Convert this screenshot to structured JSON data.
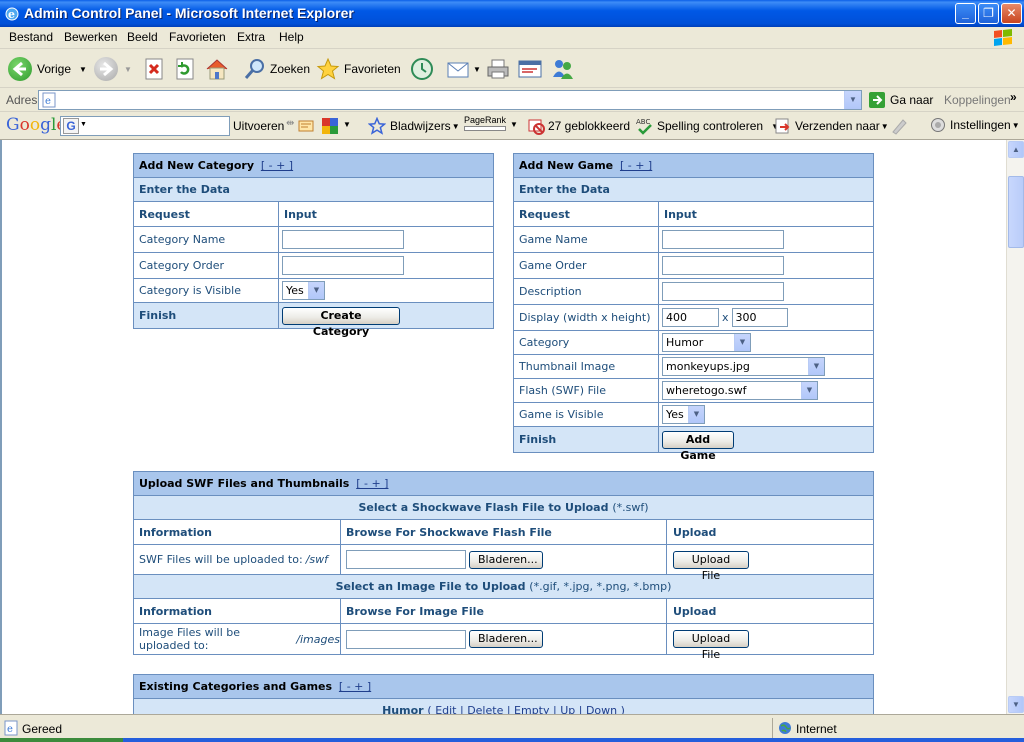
{
  "window": {
    "title": "Admin Control Panel - Microsoft Internet Explorer",
    "buttons": [
      "_",
      "❐",
      "✕"
    ]
  },
  "menu": [
    "Bestand",
    "Bewerken",
    "Beeld",
    "Favorieten",
    "Extra",
    "Help"
  ],
  "toolbar": {
    "back": "Vorige",
    "search": "Zoeken",
    "favorites": "Favorieten"
  },
  "address": {
    "label": "Adres",
    "value": "",
    "go": "Ga naar",
    "links": "Koppelingen",
    "more": "»"
  },
  "google": {
    "logo": "Google",
    "search_value": "",
    "run": "Uitvoeren",
    "bookmarks": "Bladwijzers",
    "pagerank": "PageRank",
    "blocked": "27 geblokkeerd",
    "spell": "Spelling controleren",
    "send": "Verzenden naar",
    "settings": "Instellingen"
  },
  "category_panel": {
    "title": "Add New Category",
    "toggle": "[ - + ]",
    "subheader": "Enter the Data",
    "col_request": "Request",
    "col_input": "Input",
    "rows": [
      {
        "label": "Category Name",
        "value": ""
      },
      {
        "label": "Category Order",
        "value": ""
      }
    ],
    "visible_label": "Category is Visible",
    "visible_value": "Yes",
    "finish": "Finish",
    "submit": "Create Category"
  },
  "game_panel": {
    "title": "Add New Game",
    "toggle": "[ - + ]",
    "subheader": "Enter the Data",
    "col_request": "Request",
    "col_input": "Input",
    "rows": [
      {
        "label": "Game Name",
        "value": ""
      },
      {
        "label": "Game Order",
        "value": ""
      },
      {
        "label": "Description",
        "value": ""
      }
    ],
    "display_label": "Display (width x height)",
    "display_width": "400",
    "display_x": "x",
    "display_height": "300",
    "category_label": "Category",
    "category_value": "Humor",
    "thumb_label": "Thumbnail Image",
    "thumb_value": "monkeyups.jpg",
    "flash_label": "Flash (SWF) File",
    "flash_value": "wheretogo.swf",
    "visible_label": "Game is Visible",
    "visible_value": "Yes",
    "finish": "Finish",
    "submit": "Add Game"
  },
  "upload_panel": {
    "title": "Upload SWF Files and Thumbnails",
    "toggle": "[ - + ]",
    "swf_select": "Select a Shockwave Flash File to Upload",
    "swf_ext": "(*.swf)",
    "col_info": "Information",
    "col_browse_swf": "Browse For Shockwave Flash File",
    "col_upload": "Upload",
    "swf_info": "SWF Files will be uploaded to:",
    "swf_path": "/swf",
    "browse": "Bladeren...",
    "upload_btn": "Upload File",
    "img_select": "Select an Image File to Upload",
    "img_ext": "(*.gif, *.jpg, *.png, *.bmp)",
    "col_browse_img": "Browse For Image File",
    "img_info": "Image Files will be uploaded to:",
    "img_path": "/images"
  },
  "existing_panel": {
    "title": "Existing Categories and Games",
    "toggle": "[ - + ]",
    "first_category": "Humor",
    "actions": "( Edit | Delete | Empty | Up | Down )"
  },
  "status": {
    "text": "Gereed",
    "zone": "Internet"
  }
}
